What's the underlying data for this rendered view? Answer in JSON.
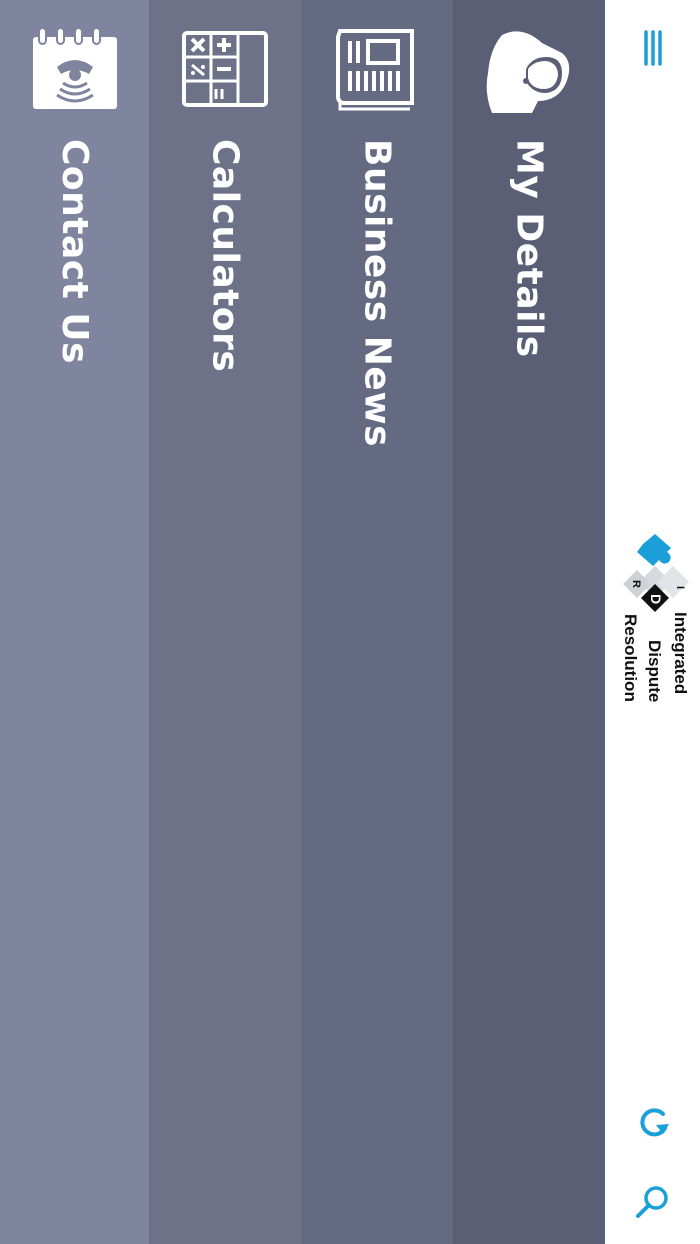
{
  "menu_panels": [
    {
      "id": "contact",
      "label": "Contact Us",
      "icon": "contact-phone-icon"
    },
    {
      "id": "calculators",
      "label": "Calculators",
      "icon": "calculator-icon"
    },
    {
      "id": "news",
      "label": "Business News",
      "icon": "newspaper-icon"
    },
    {
      "id": "details",
      "label": "My Details",
      "icon": "user-profile-icon"
    }
  ],
  "logo": {
    "line1": "Integrated",
    "line2": "Dispute",
    "line3": "Resolution",
    "mark_letters": [
      "I",
      "D",
      "R"
    ]
  },
  "sidebar": {
    "menu_icon": "hamburger-menu-icon",
    "refresh_icon": "refresh-icon",
    "search_icon": "search-icon"
  },
  "colors": {
    "accent": "#1a9fd9",
    "panel_contact": "#7f859f",
    "panel_calculators": "#6d7289",
    "panel_news": "#656a83",
    "panel_details": "#5a5f76"
  }
}
